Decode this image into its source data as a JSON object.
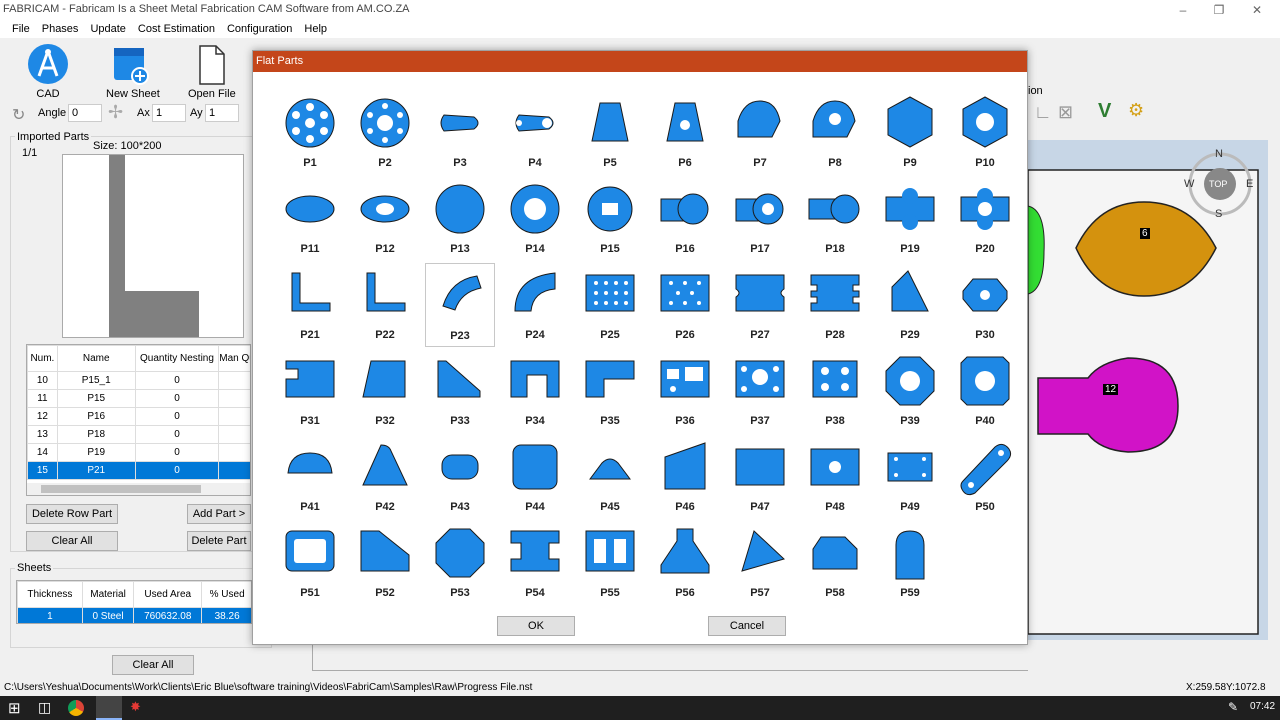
{
  "window": {
    "title": "FABRICAM - Fabricam Is a Sheet Metal Fabrication CAM Software from AM.CO.ZA"
  },
  "menu": [
    "File",
    "Phases",
    "Update",
    "Cost Estimation",
    "Configuration",
    "Help"
  ],
  "toolbar": {
    "cad": "CAD",
    "new_sheet": "New Sheet",
    "open_file": "Open File"
  },
  "transform": {
    "angle_label": "Angle",
    "angle_value": "0",
    "ax_label": "Ax",
    "ax_value": "1",
    "ay_label": "Ay",
    "ay_value": "1"
  },
  "imported_parts": {
    "title": "Imported Parts",
    "page": "1/1",
    "size": "Size: 100*200",
    "headers": [
      "Num.",
      "Name",
      "Quantity Nesting",
      "Man Quan"
    ],
    "rows": [
      {
        "num": "10",
        "name": "P15_1",
        "qty": "0"
      },
      {
        "num": "11",
        "name": "P15",
        "qty": "0"
      },
      {
        "num": "12",
        "name": "P16",
        "qty": "0"
      },
      {
        "num": "13",
        "name": "P18",
        "qty": "0"
      },
      {
        "num": "14",
        "name": "P19",
        "qty": "0"
      },
      {
        "num": "15",
        "name": "P21",
        "qty": "0"
      }
    ],
    "buttons": {
      "delete_row": "Delete Row Part",
      "add_part": "Add Part >",
      "clear_all": "Clear All",
      "delete_part": "Delete Part"
    }
  },
  "sheets": {
    "title": "Sheets",
    "headers": [
      "Thickness",
      "Material",
      "Used Area",
      "% Used"
    ],
    "row": {
      "thickness": "1",
      "material": "0 Steel",
      "used_area": "760632.08",
      "used": "38.26"
    },
    "clear_all": "Clear All"
  },
  "right": {
    "label": "ion",
    "compass": {
      "n": "N",
      "s": "S",
      "e": "E",
      "w": "W",
      "top": "TOP"
    },
    "parts": {
      "p6": "6",
      "p12": "12"
    }
  },
  "dialog": {
    "title": "Flat Parts",
    "selected": "P23",
    "ok": "OK",
    "cancel": "Cancel",
    "parts": [
      "P1",
      "P2",
      "P3",
      "P4",
      "P5",
      "P6",
      "P7",
      "P8",
      "P9",
      "P10",
      "P11",
      "P12",
      "P13",
      "P14",
      "P15",
      "P16",
      "P17",
      "P18",
      "P19",
      "P20",
      "P21",
      "P22",
      "P23",
      "P24",
      "P25",
      "P26",
      "P27",
      "P28",
      "P29",
      "P30",
      "P31",
      "P32",
      "P33",
      "P34",
      "P35",
      "P36",
      "P37",
      "P38",
      "P39",
      "P40",
      "P41",
      "P42",
      "P43",
      "P44",
      "P45",
      "P46",
      "P47",
      "P48",
      "P49",
      "P50",
      "P51",
      "P52",
      "P53",
      "P54",
      "P55",
      "P56",
      "P57",
      "P58",
      "P59"
    ]
  },
  "status": {
    "path": "C:\\Users\\Yeshua\\Documents\\Work\\Clients\\Eric Blue\\software training\\Videos\\FabriCam\\Samples\\Raw\\Progress File.nst",
    "coords": "X:259.58Y:1072.8"
  },
  "taskbar": {
    "time": "07:42"
  },
  "colors": {
    "part_fill": "#1e88e5",
    "dialog_title": "#c4461a",
    "selection": "#0078d7"
  }
}
